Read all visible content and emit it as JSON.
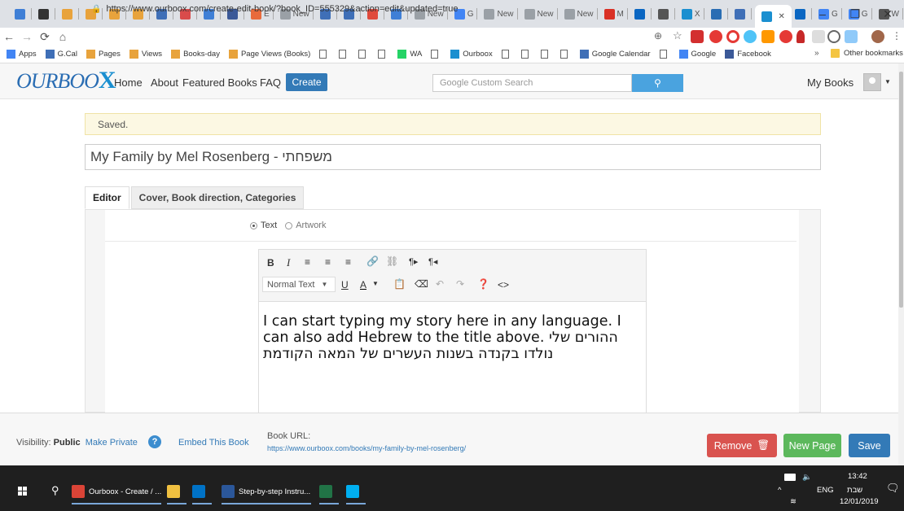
{
  "browser": {
    "tabs": [
      {
        "label": "",
        "color": "#3f7fd6"
      },
      {
        "label": "",
        "color": "#333333"
      },
      {
        "label": "",
        "color": "#e8a33c"
      },
      {
        "label": "",
        "color": "#e8a33c"
      },
      {
        "label": "",
        "color": "#e8a33c"
      },
      {
        "label": "",
        "color": "#e8a33c"
      },
      {
        "label": "",
        "color": "#3f6fb7"
      },
      {
        "label": "",
        "color": "#d94b4b"
      },
      {
        "label": "",
        "color": "#3f7fd6"
      },
      {
        "label": "",
        "color": "#3b5998"
      },
      {
        "label": "E",
        "color": "#e86a3c"
      },
      {
        "label": "New",
        "color": "#9aa0a6"
      },
      {
        "label": "",
        "color": "#3f6fb7"
      },
      {
        "label": "",
        "color": "#3f6fb7"
      },
      {
        "label": "",
        "color": "#e04a3c"
      },
      {
        "label": "",
        "color": "#3f7fd6"
      },
      {
        "label": "New",
        "color": "#9aa0a6"
      },
      {
        "label": "G",
        "color": "#4285f4"
      },
      {
        "label": "New",
        "color": "#9aa0a6"
      },
      {
        "label": "New",
        "color": "#9aa0a6"
      },
      {
        "label": "New",
        "color": "#9aa0a6"
      },
      {
        "label": "M",
        "color": "#d93025"
      },
      {
        "label": "",
        "color": "#0a66c2"
      },
      {
        "label": "",
        "color": "#555555"
      },
      {
        "label": "X",
        "color": "#1a8fd0"
      },
      {
        "label": "",
        "color": "#2a6db3"
      },
      {
        "label": "",
        "color": "#3f6fb7"
      }
    ],
    "active_tab_label": "",
    "trailing_tabs": [
      {
        "label": "",
        "color": "#0a66c2"
      },
      {
        "label": "G",
        "color": "#4285f4"
      },
      {
        "label": "G",
        "color": "#4285f4"
      },
      {
        "label": "W",
        "color": "#555555"
      }
    ],
    "new_tab": "+",
    "window_controls": {
      "minimize": "–",
      "maximize": "❐",
      "close": "✕"
    },
    "url": "https://www.ourboox.com/create-edit-book/?book_ID=555329&action=edit&updated=true",
    "bookmarks": [
      {
        "label": "Apps",
        "icon": "apps-grid-icon",
        "color": "#4285f4"
      },
      {
        "label": "G.Cal",
        "icon": "calendar-icon",
        "color": "#3f6fb7"
      },
      {
        "label": "Pages",
        "icon": "analytics-icon",
        "color": "#e8a33c"
      },
      {
        "label": "Views",
        "icon": "analytics-icon",
        "color": "#e8a33c"
      },
      {
        "label": "Books-day",
        "icon": "analytics-icon",
        "color": "#e8a33c"
      },
      {
        "label": "Page Views (Books)",
        "icon": "analytics-icon",
        "color": "#e8a33c"
      },
      {
        "label": "",
        "icon": "doc-icon",
        "color": "#666666"
      },
      {
        "label": "",
        "icon": "doc-icon",
        "color": "#666666"
      },
      {
        "label": "",
        "icon": "doc-icon",
        "color": "#666666"
      },
      {
        "label": "",
        "icon": "doc-icon",
        "color": "#666666"
      },
      {
        "label": "WA",
        "icon": "whatsapp-icon",
        "color": "#25d366"
      },
      {
        "label": "",
        "icon": "doc-icon",
        "color": "#666666"
      },
      {
        "label": "Ourboox",
        "icon": "ourboox-icon",
        "color": "#1a8fd0"
      },
      {
        "label": "",
        "icon": "doc-icon",
        "color": "#666666"
      },
      {
        "label": "",
        "icon": "doc-icon",
        "color": "#666666"
      },
      {
        "label": "",
        "icon": "doc-icon",
        "color": "#666666"
      },
      {
        "label": "",
        "icon": "doc-icon",
        "color": "#666666"
      },
      {
        "label": "Google Calendar",
        "icon": "calendar-icon",
        "color": "#3f6fb7"
      },
      {
        "label": "",
        "icon": "doc-icon",
        "color": "#666666"
      },
      {
        "label": "Google",
        "icon": "google-icon",
        "color": "#4285f4"
      },
      {
        "label": "Facebook",
        "icon": "facebook-icon",
        "color": "#3b5998"
      }
    ],
    "more_bookmarks": "»",
    "other_bookmarks": "Other bookmarks"
  },
  "site": {
    "logo_text": "OURBOO",
    "logo_x": "X",
    "nav": [
      "Home",
      "About",
      "Featured Books",
      "FAQ"
    ],
    "create_label": "Create",
    "search_placeholder": "Google Custom Search",
    "my_books": "My Books"
  },
  "editor": {
    "status": "Saved.",
    "title": "My Family by Mel Rosenberg - משפחתי",
    "tabs": [
      "Editor",
      "Cover, Book direction, Categories"
    ],
    "radio_text": "Text",
    "radio_artwork": "Artwork",
    "format_select": "Normal Text",
    "toolbar_row1": [
      "B",
      "I",
      "≡",
      "≡",
      "≡",
      "🔗",
      "⛓",
      "¶▸",
      "¶◂"
    ],
    "content": "I can start typing my story here in any language. I can also add Hebrew to the title above. ההורים שלי נולדו בקנדה בשנות העשרים של המאה הקודמת"
  },
  "footer": {
    "visibility_label": "Visibility:",
    "visibility_value": "Public",
    "make_private": "Make Private",
    "help": "?",
    "embed": "Embed This Book",
    "book_url_label": "Book URL:",
    "book_url": "https://www.ourboox.com/books/my-family-by-mel-rosenberg/",
    "remove": "Remove",
    "new_page": "New Page",
    "save": "Save"
  },
  "taskbar": {
    "items": [
      {
        "label": "Ourboox - Create / ...",
        "color": "#db4437"
      },
      {
        "label": "",
        "color": "#f0c040"
      },
      {
        "label": "",
        "color": "#0072c6"
      },
      {
        "label": "Step-by-step Instru...",
        "color": "#2b579a"
      },
      {
        "label": "",
        "color": "#217346"
      },
      {
        "label": "",
        "color": "#00aff0"
      }
    ],
    "language": "ENG",
    "time": "13:42",
    "day": "שבת",
    "date": "12/01/2019"
  }
}
